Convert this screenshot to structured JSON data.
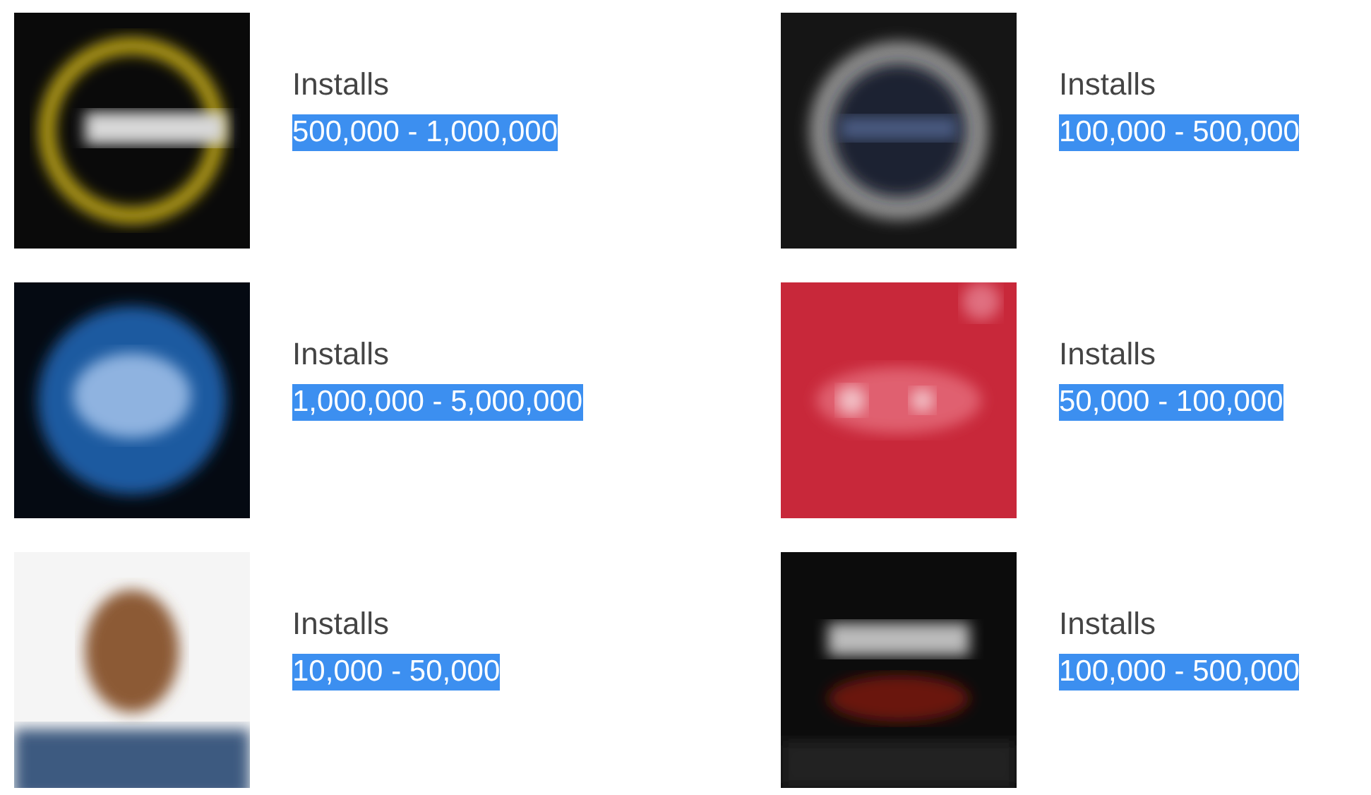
{
  "apps": [
    {
      "kind": "picture",
      "label": "Installs",
      "value": "500,000 - 1,000,000",
      "highlighted": true
    },
    {
      "kind": "picture",
      "label": "Installs",
      "value": "100,000 - 500,000",
      "highlighted": true
    },
    {
      "kind": "picture",
      "label": "Installs",
      "value": "1,000,000 - 5,000,000",
      "highlighted": true
    },
    {
      "kind": "picture",
      "label": "Installs",
      "value": "50,000 - 100,000",
      "highlighted": true
    },
    {
      "kind": "picture",
      "label": "Installs",
      "value": "10,000 - 50,000",
      "highlighted": true
    },
    {
      "kind": "picture",
      "label": "Installs",
      "value": "100,000 - 500,000",
      "highlighted": true
    }
  ]
}
